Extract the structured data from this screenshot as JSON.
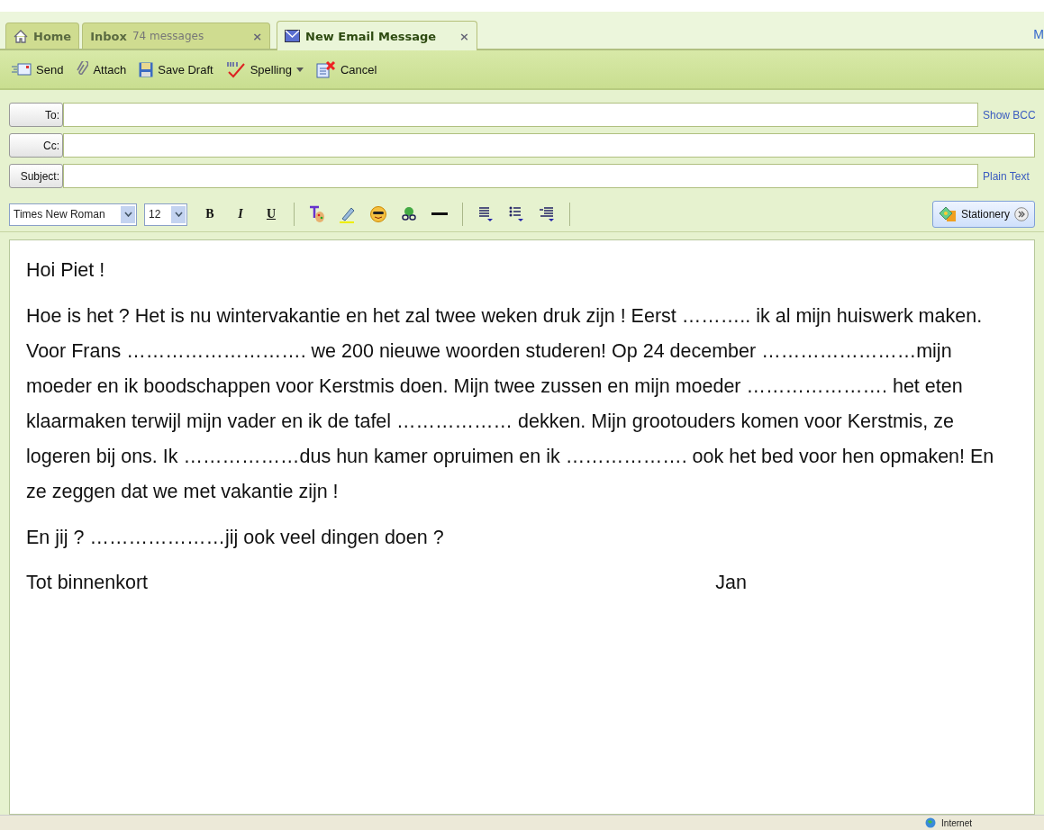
{
  "tabs": [
    {
      "kind": "home",
      "label": "Home",
      "selected": false
    },
    {
      "kind": "list",
      "label": "Inbox",
      "count": "74 messages",
      "close": "×",
      "selected": false
    },
    {
      "kind": "mail",
      "label": "New Email Message",
      "close": "×",
      "selected": true
    }
  ],
  "edge_text": "M",
  "toolbar": [
    {
      "kind": "send",
      "label": "Send"
    },
    {
      "kind": "attach",
      "label": "Attach"
    },
    {
      "kind": "save",
      "label": "Save Draft"
    },
    {
      "kind": "spell",
      "label": "Spelling",
      "dropdown": true
    },
    {
      "kind": "cancel",
      "label": "Cancel"
    }
  ],
  "fields": [
    {
      "label": "To:",
      "link": "Show BCC"
    },
    {
      "label": "Cc:"
    },
    {
      "label": "Subject:",
      "link": "Plain Text"
    }
  ],
  "format_bar": {
    "font": "Times New Roman",
    "size": "12",
    "bold": "B",
    "italic": "I",
    "underline": "U",
    "stationery": "Stationery"
  },
  "body": [
    "Hoi Piet !",
    "Hoe is het ? Het is nu wintervakantie en het zal twee weken druk zijn ! Eerst ……….. ik al mijn huiswerk maken. Voor Frans ………………………. we 200 nieuwe woorden studeren! Op 24 december ……………………mijn moeder en ik boodschappen voor Kerstmis doen. Mijn twee zussen en mijn moeder …………………. het eten klaarmaken terwijl mijn vader en ik de tafel ……………… dekken. Mijn grootouders komen voor Kerstmis, ze logeren bij ons. Ik ………………dus hun kamer opruimen en ik ………………. ook het bed voor hen opmaken! En ze zeggen dat we met vakantie zijn !",
    "En jij ? …………………jij ook veel dingen doen ?"
  ],
  "closing": "Tot binnenkort",
  "signature": "Jan",
  "status_bar": {
    "zone": "Internet"
  }
}
